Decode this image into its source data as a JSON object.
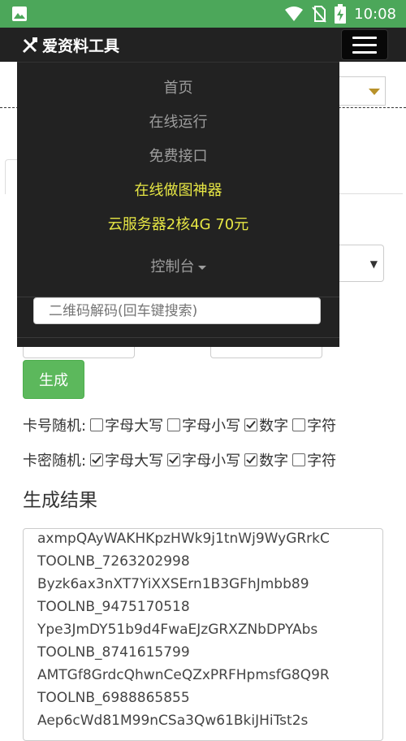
{
  "status_bar": {
    "time": "10:08",
    "icons": [
      "image-icon",
      "wifi-icon",
      "no-sim-icon",
      "battery-charging-icon"
    ]
  },
  "navbar": {
    "brand": "爱资料工具",
    "brand_icon": "tools-icon",
    "toggle_icon": "hamburger-icon"
  },
  "menu": {
    "items": [
      {
        "label": "首页",
        "highlight": false
      },
      {
        "label": "在线运行",
        "highlight": false
      },
      {
        "label": "免费接口",
        "highlight": false
      },
      {
        "label": "在线做图神器",
        "highlight": true
      },
      {
        "label": "云服务器2核4G 70元",
        "highlight": true
      },
      {
        "label": "控制台",
        "highlight": false,
        "dropdown": true
      }
    ],
    "search_placeholder": "二维码解码(回车键搜索)"
  },
  "form": {
    "generate_label": "生成",
    "card_number": {
      "label": "卡号随机:",
      "options": [
        {
          "label": "字母大写",
          "checked": false
        },
        {
          "label": "字母小写",
          "checked": false
        },
        {
          "label": "数字",
          "checked": true
        },
        {
          "label": "字符",
          "checked": false
        }
      ]
    },
    "card_password": {
      "label": "卡密随机:",
      "options": [
        {
          "label": "字母大写",
          "checked": true
        },
        {
          "label": "字母小写",
          "checked": true
        },
        {
          "label": "数字",
          "checked": true
        },
        {
          "label": "字符",
          "checked": false
        }
      ]
    }
  },
  "result": {
    "title": "生成结果",
    "lines": [
      "axmpQAyWAKHKpzHWk9j1tnWj9WyGRrkC",
      "TOOLNB_7263202998",
      "Byzk6ax3nXT7YiXXSErn1B3GFhJmbb89",
      "TOOLNB_9475170518",
      "Ype3JmDY51b9d4FwaEJzGRXZNbDPYAbs",
      "TOOLNB_8741615799",
      "AMTGf8GrdcQhwnCeQZxPRFHpmsfG8Q9R",
      "TOOLNB_6988865855",
      "Aep6cWd81M99nCSa3Qw61BkiJHiTst2s"
    ]
  }
}
